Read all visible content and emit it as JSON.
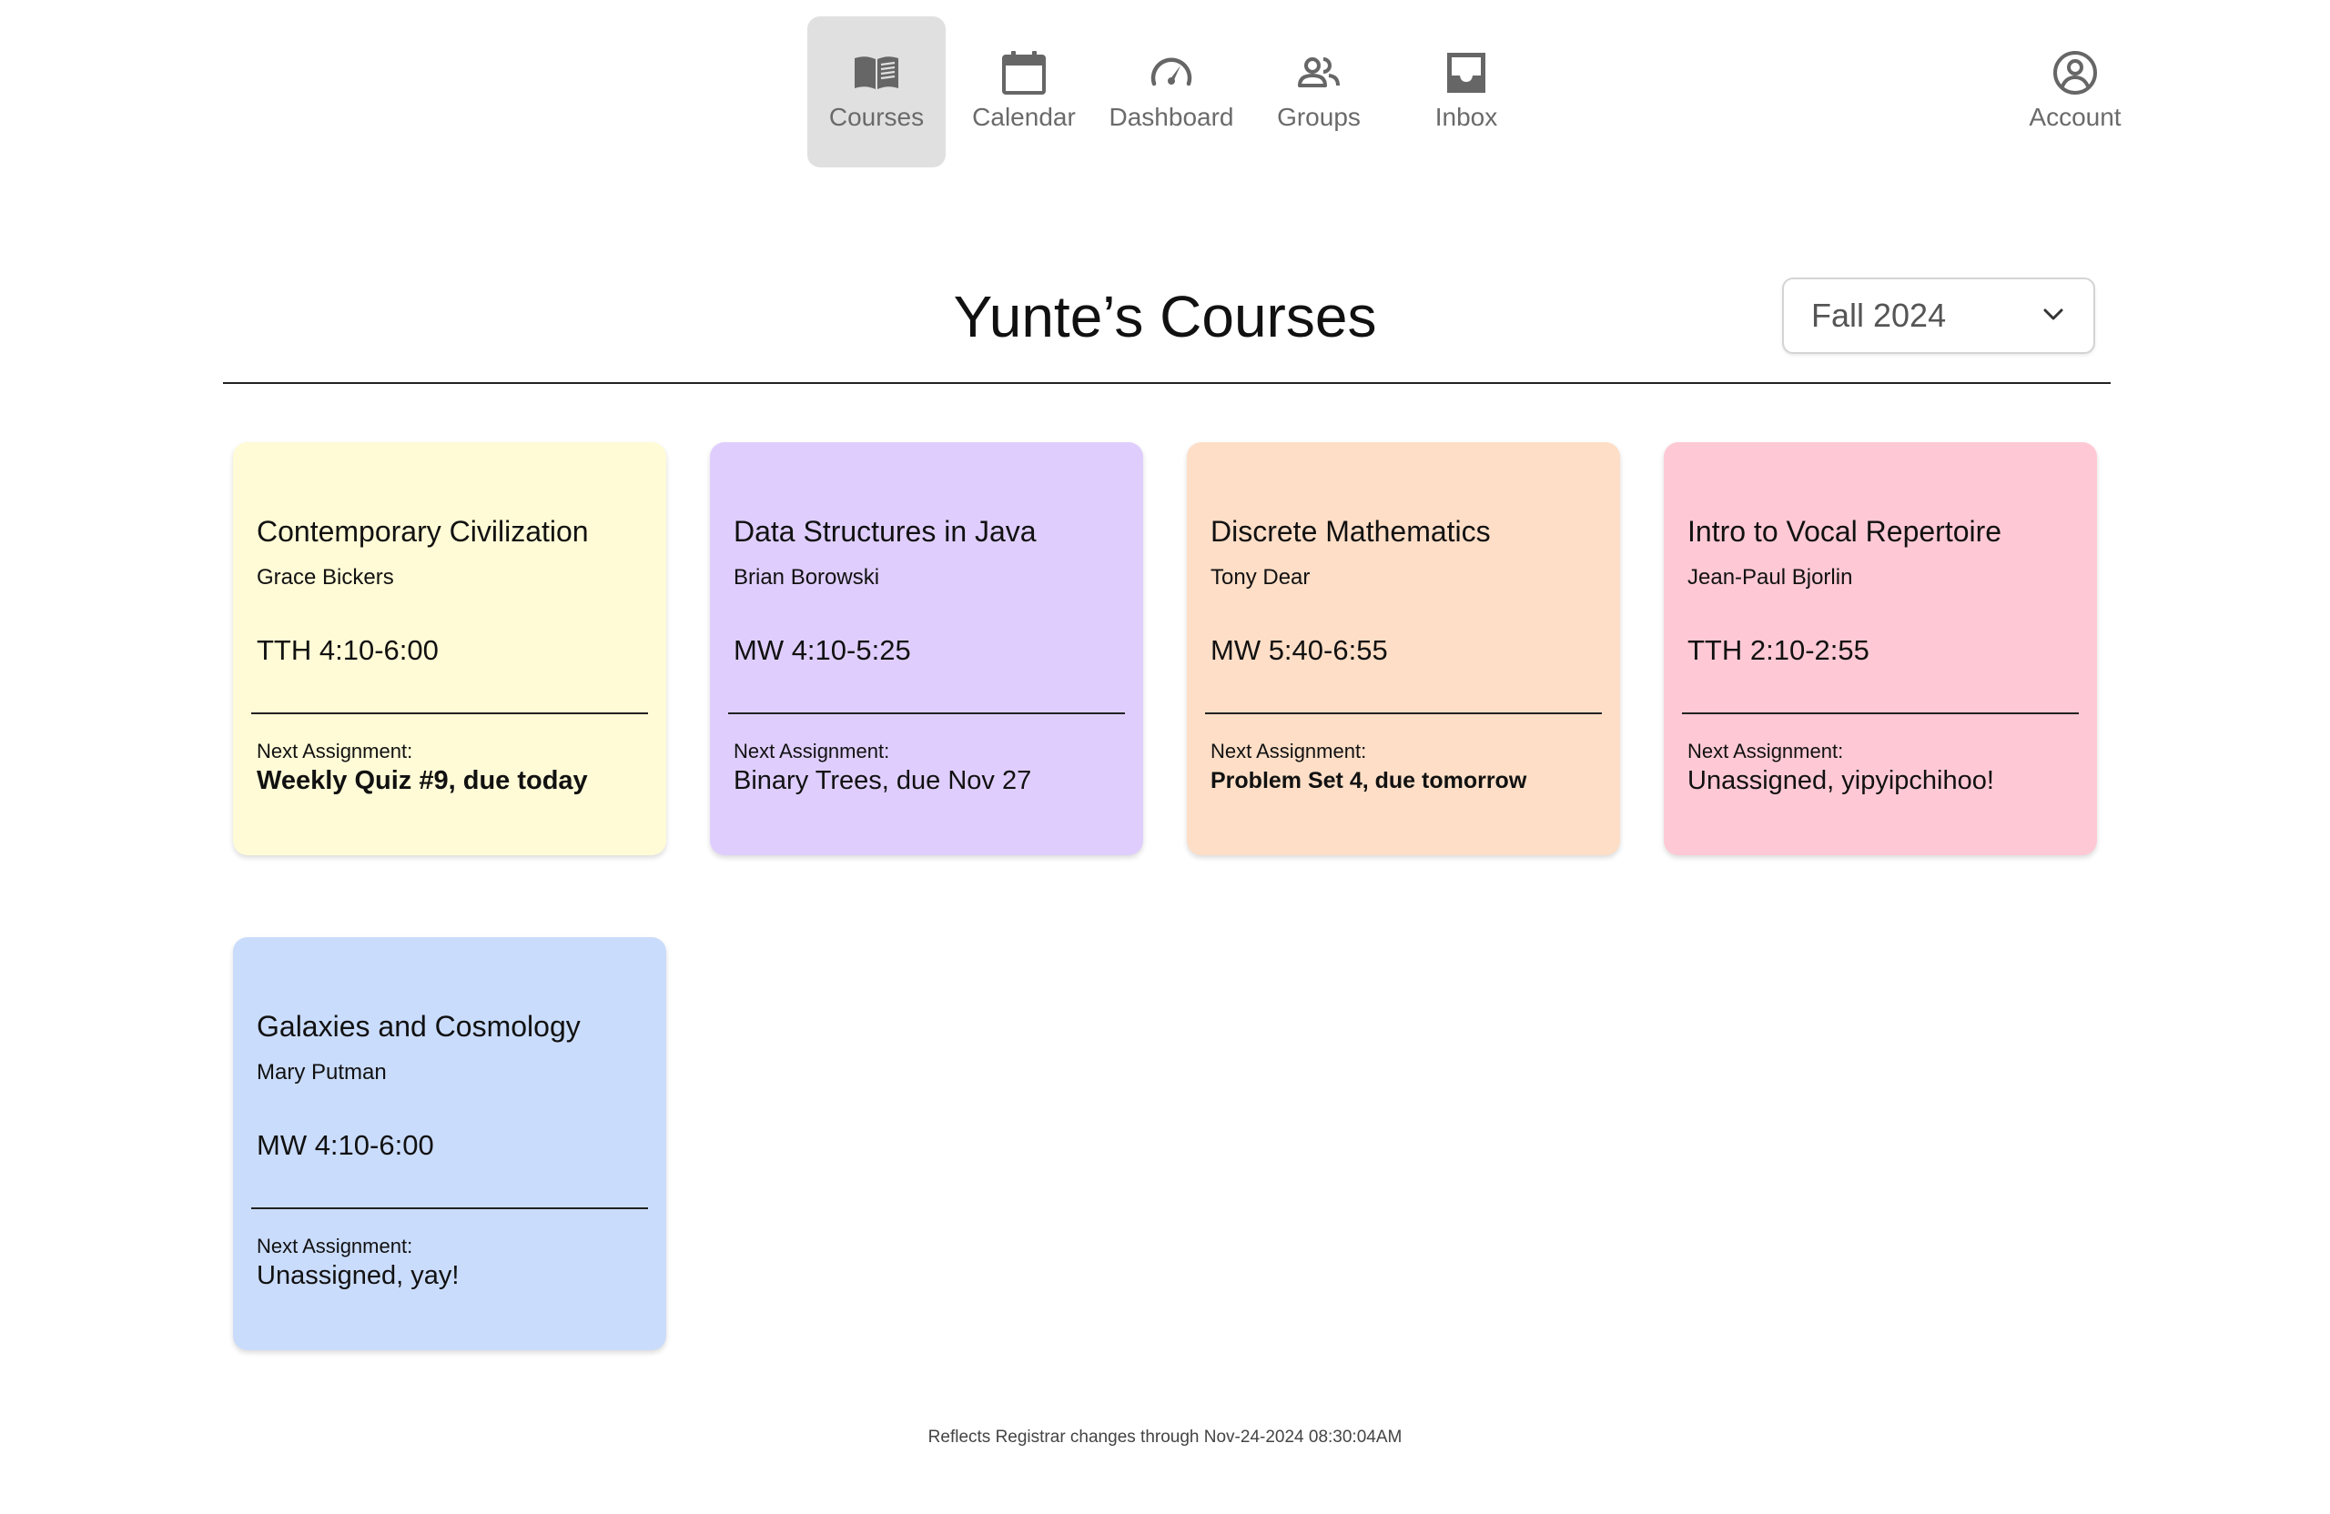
{
  "nav": {
    "items": [
      {
        "label": "Courses",
        "icon": "book-open-icon",
        "active": true
      },
      {
        "label": "Calendar",
        "icon": "calendar-icon",
        "active": false
      },
      {
        "label": "Dashboard",
        "icon": "speedometer-icon",
        "active": false
      },
      {
        "label": "Groups",
        "icon": "people-icon",
        "active": false
      },
      {
        "label": "Inbox",
        "icon": "inbox-icon",
        "active": false
      }
    ],
    "account_label": "Account",
    "account_icon": "account-circle-icon"
  },
  "header": {
    "title": "Yunte’s Courses",
    "term_selected": "Fall 2024",
    "term_icon": "chevron-down-icon"
  },
  "courses": [
    {
      "title": "Contemporary Civilization",
      "instructor": "Grace Bickers",
      "schedule": "TTH 4:10-6:00",
      "next_label": "Next Assignment:",
      "next_assignment": "Weekly Quiz #9, due today",
      "color": "#fffbd6"
    },
    {
      "title": "Data Structures in Java",
      "instructor": "Brian Borowski",
      "schedule": "MW 4:10-5:25",
      "next_label": "Next Assignment:",
      "next_assignment": "Binary Trees, due Nov 27",
      "color": "#dfcefd"
    },
    {
      "title": "Discrete Mathematics",
      "instructor": "Tony Dear",
      "schedule": "MW 5:40-6:55",
      "next_label": "Next Assignment:",
      "next_assignment": "Problem Set 4, due tomorrow",
      "color": "#fedec7"
    },
    {
      "title": "Intro to Vocal Repertoire",
      "instructor": "Jean-Paul Bjorlin",
      "schedule": "TTH 2:10-2:55",
      "next_label": "Next Assignment:",
      "next_assignment": "Unassigned, yipyipchihoo!",
      "color": "#fec9d5"
    },
    {
      "title": "Galaxies and Cosmology",
      "instructor": "Mary Putman",
      "schedule": "MW 4:10-6:00",
      "next_label": "Next Assignment:",
      "next_assignment": "Unassigned, yay!",
      "color": "#cadcfc"
    }
  ],
  "footer": {
    "text": "Reflects Registrar changes through Nov-24-2024 08:30:04AM"
  },
  "colors": {
    "nav_active_bg": "#e0e0e0",
    "icon_gray": "#666666"
  }
}
